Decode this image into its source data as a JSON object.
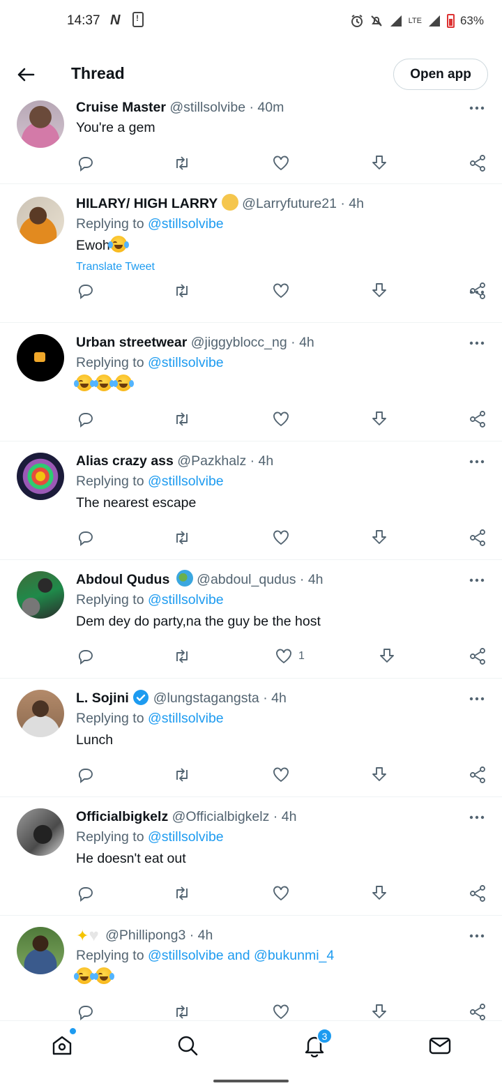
{
  "status_bar": {
    "time": "14:37",
    "network_type": "LTE",
    "battery": "63%"
  },
  "header": {
    "title": "Thread",
    "open_app_label": "Open app"
  },
  "tweets": [
    {
      "name": "Cruise Master",
      "handle": "@stillsolvibe",
      "time": "40m",
      "replying_to": null,
      "text": "You're a gem",
      "likes": ""
    },
    {
      "name": "HILARY/ HIGH LARRY",
      "name_emoji": "technologist-emoji",
      "handle": "@Larryfuture21",
      "time": "4h",
      "replying_prefix": "Replying to",
      "replying_to": "@stillsolvibe",
      "text": "Ewoh",
      "text_emoji": "joy-emoji",
      "translate_label": "Translate Tweet",
      "likes": ""
    },
    {
      "name": "Urban streetwear",
      "handle": "@jiggyblocc_ng",
      "time": "4h",
      "replying_prefix": "Replying to",
      "replying_to": "@stillsolvibe",
      "text": "",
      "text_emoji": "joy-emoji x3",
      "likes": ""
    },
    {
      "name": "Alias crazy ass",
      "handle": "@Pazkhalz",
      "time": "4h",
      "replying_prefix": "Replying to",
      "replying_to": "@stillsolvibe",
      "text": "The nearest escape",
      "likes": ""
    },
    {
      "name": "Abdoul Qudus",
      "name_emoji": "globe-africa-emoji",
      "handle": "@abdoul_qudus",
      "time": "4h",
      "replying_prefix": "Replying to",
      "replying_to": "@stillsolvibe",
      "text": "Dem dey do party,na the guy be the host",
      "likes": "1"
    },
    {
      "name": "L. Sojini",
      "verified": true,
      "handle": "@lungstagangsta",
      "time": "4h",
      "replying_prefix": "Replying to",
      "replying_to": "@stillsolvibe",
      "text": "Lunch",
      "likes": ""
    },
    {
      "name": "Officialbigkelz",
      "handle": "@Officialbigkelz",
      "time": "4h",
      "replying_prefix": "Replying to",
      "replying_to": "@stillsolvibe",
      "text": "He doesn't eat out",
      "likes": ""
    },
    {
      "name": "",
      "name_emoji": "sparkles-white-heart-emoji",
      "handle": "@Phillipong3",
      "time": "4h",
      "replying_prefix": "Replying to",
      "replying_to": "@stillsolvibe",
      "replying_and": "and",
      "replying_to_2": "@bukunmi_4",
      "text": "",
      "text_emoji": "joy-emoji x2",
      "likes": ""
    }
  ],
  "separator": "·",
  "bottom_nav": {
    "items": [
      "home-icon",
      "search-icon",
      "notifications-icon",
      "messages-icon"
    ],
    "notification_count": "3"
  },
  "colors": {
    "accent": "#1d9bf0",
    "text": "#0f1419",
    "secondary": "#536471",
    "divider": "#eff3f4"
  }
}
